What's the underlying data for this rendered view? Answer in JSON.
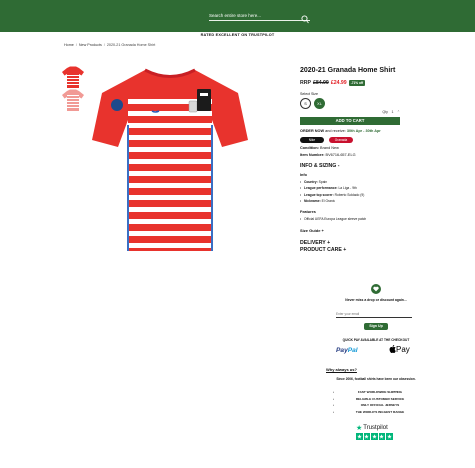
{
  "header": {
    "search_placeholder": "Search entire store here...",
    "brand_color": "#2f6b34"
  },
  "trust_banner": "RATED EXCELLENT ON TRUSTPILOT",
  "breadcrumb": {
    "home": "Home",
    "sep1": "/",
    "category": "New Products",
    "sep2": "/",
    "current": "2020-21 Granada Home Shirt"
  },
  "product": {
    "title": "2020-21 Granada Home Shirt",
    "rrp_label": "RRP",
    "rrp_price": "£84.99",
    "price": "£24.99",
    "discount": "-71% off",
    "size_label": "Select Size",
    "sizes": [
      "S",
      "XL"
    ],
    "selected_size": "XL",
    "qty_label": "Qty",
    "qty_value": "1",
    "add_to_cart": "ADD TO CART",
    "order_now": "ORDER NOW",
    "receive_text": "and receive:",
    "delivery_dates": "30th Apr - 30th Apr",
    "tags": [
      "Nike",
      "Granada"
    ],
    "condition_label": "Condition:",
    "condition_value": "Brand New",
    "item_number_label": "Item Number:",
    "item_number_value": "BV6716-657-ELG",
    "info_heading": "INFO & SIZING -",
    "info_sub": "Info",
    "info_items": [
      {
        "label": "Country:",
        "value": "Spain"
      },
      {
        "label": "League performance:",
        "value": "La Liga - 9th"
      },
      {
        "label": "League top scorer:",
        "value": "Roberto Soldado (9)"
      },
      {
        "label": "Nickname:",
        "value": "El Graná"
      }
    ],
    "features_sub": "Features",
    "features": [
      "Official UEFA Europa League sleeve patch"
    ],
    "size_guide": "Size Guide +",
    "delivery": "DELIVERY +",
    "care": "PRODUCT CARE +"
  },
  "newsletter": {
    "text": "Never miss a drop or discount again...",
    "placeholder": "Enter your email",
    "button": "Sign Up"
  },
  "payments": {
    "heading": "QUICK PAY AVAILABLE AT THE CHECKOUT",
    "paypal_a": "Pay",
    "paypal_b": "Pal",
    "applepay": "Pay"
  },
  "why": {
    "link": "Why always us?",
    "since": "Since 2006, football shirts have been our obsession.",
    "usps": [
      "FAST WORLDWIDE SHIPPING",
      "RELIABLE CUSTOMER SERVICE",
      "ONLY OFFICIAL JERSEYS",
      "THE WORLD'S BIGGEST RANGE"
    ]
  },
  "trustpilot": {
    "label": "Trustpilot",
    "rating_stars": 5
  },
  "colors": {
    "shirt_red": "#e8332d",
    "price_red": "#e21f24",
    "green": "#2f6b34"
  }
}
